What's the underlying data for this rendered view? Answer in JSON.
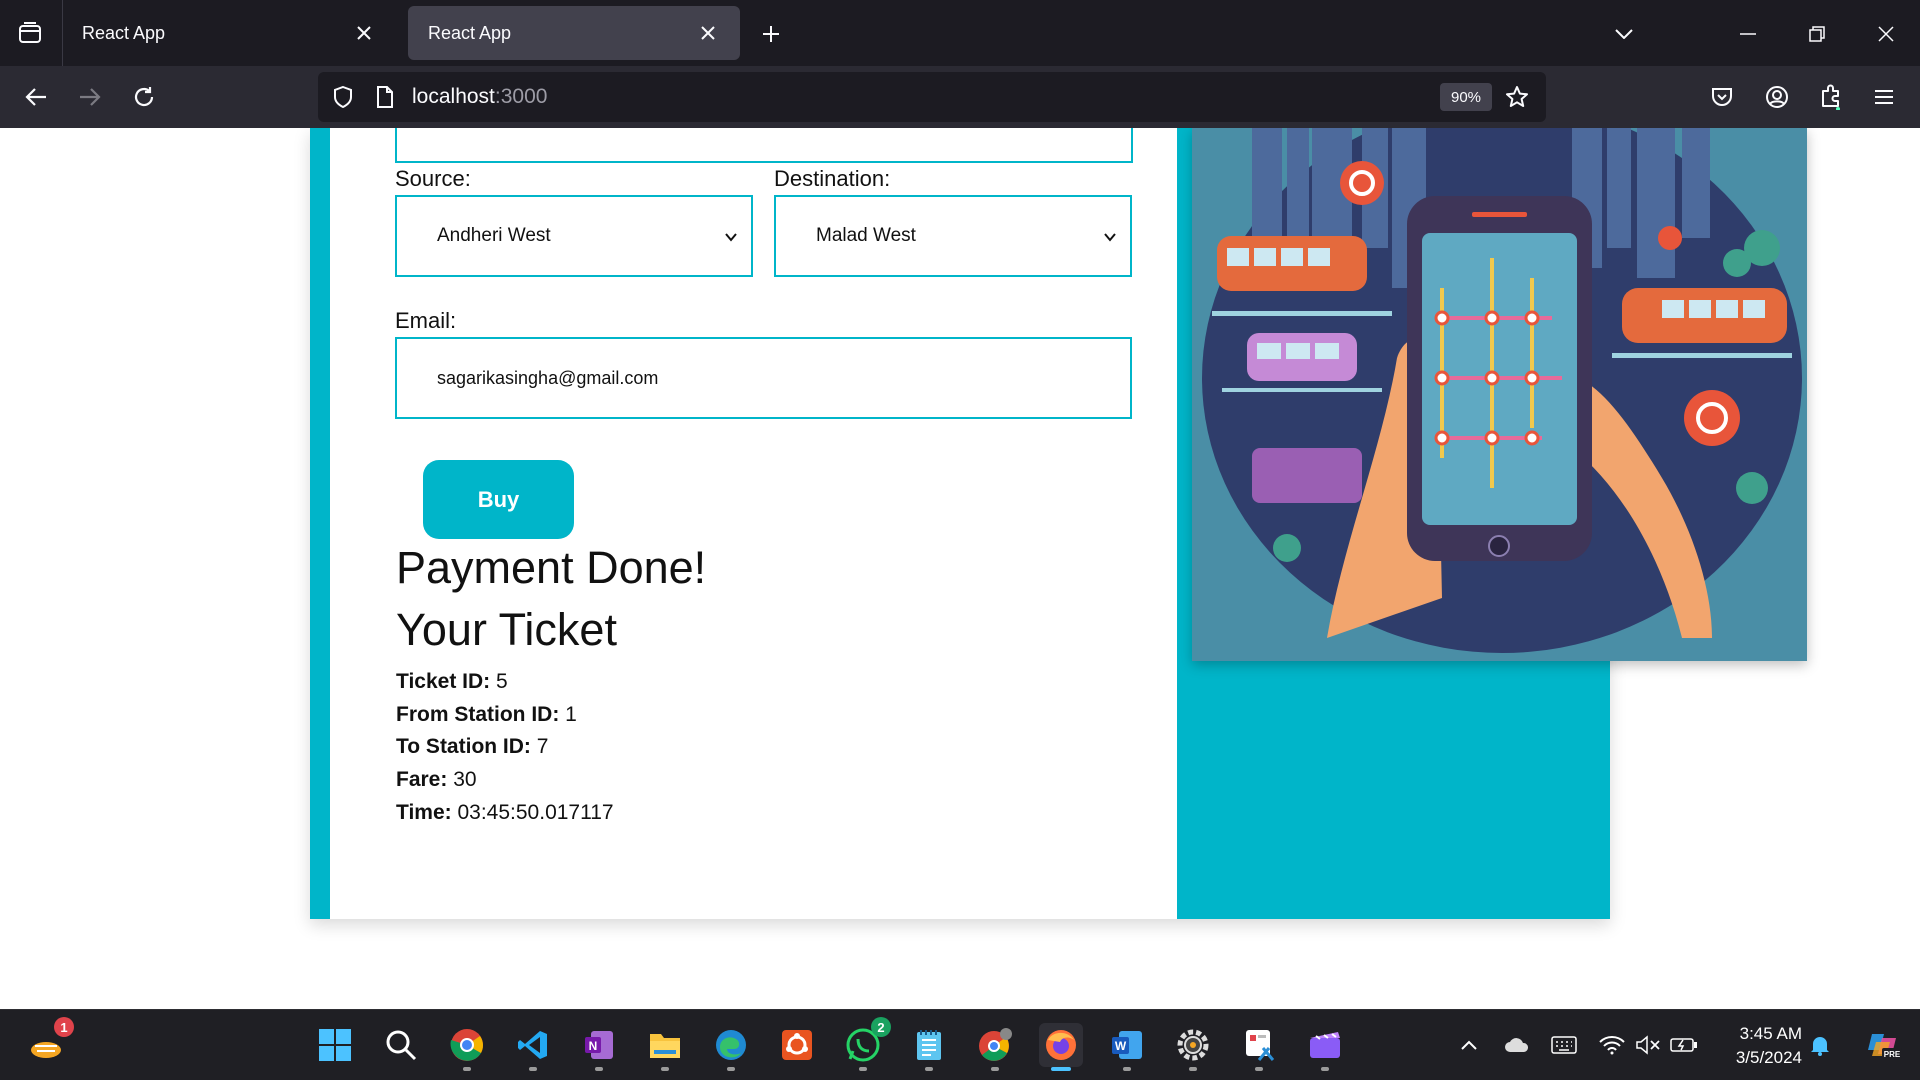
{
  "browser": {
    "tabs": [
      {
        "title": "React App",
        "active": false
      },
      {
        "title": "React App",
        "active": true
      }
    ],
    "url_host": "localhost",
    "url_port": ":3000",
    "zoom": "90%"
  },
  "form": {
    "source_label": "Source:",
    "source_value": "Andheri West",
    "destination_label": "Destination:",
    "destination_value": "Malad West",
    "email_label": "Email:",
    "email_value": "sagarikasingha@gmail.com",
    "buy_label": "Buy"
  },
  "result": {
    "payment_message": "Payment Done!",
    "ticket_heading": "Your Ticket",
    "ticket_id_label": "Ticket ID:",
    "ticket_id": "5",
    "from_label": "From Station ID:",
    "from_id": "1",
    "to_label": "To Station ID:",
    "to_id": "7",
    "fare_label": "Fare:",
    "fare": "30",
    "time_label": "Time:",
    "time": "03:45:50.017117"
  },
  "taskbar": {
    "widgets_badge": "1",
    "whatsapp_badge": "2",
    "time": "3:45 AM",
    "date": "3/5/2024",
    "copilot_tag": "PRE"
  },
  "colors": {
    "accent_teal": "#00b5c9",
    "chrome_dark": "#1c1b22",
    "chrome_mid": "#2b2a33",
    "active_tab": "#42414d"
  }
}
